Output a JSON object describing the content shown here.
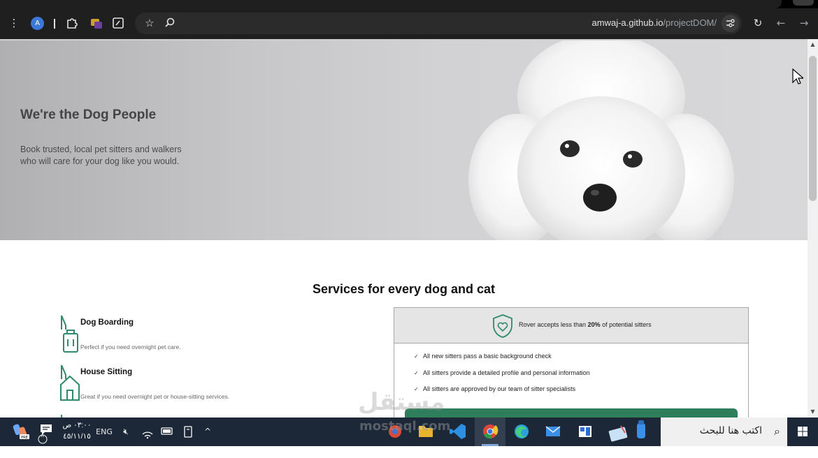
{
  "browser": {
    "url_host": "amwaj-a.github.io",
    "url_path": "/projectDOM/",
    "profile_initial": "A",
    "icons": [
      "menu-icon",
      "extensions-icon",
      "tab-search-icon",
      "bookmark-star-icon",
      "zoom-icon",
      "site-info-icon",
      "reload-icon",
      "back-icon",
      "forward-icon"
    ]
  },
  "hero": {
    "title": "We're the Dog People",
    "text": "Book trusted, local pet sitters and walkers who will care for your dog like you would."
  },
  "services": {
    "title": "Services for every dog and cat",
    "items": [
      {
        "title": "Dog Boarding",
        "desc": "Perfect if you need overnight pet care.",
        "icon": "suitcase-icon"
      },
      {
        "title": "House Sitting",
        "desc": "Great if you need overnight pet or house-sitting services.",
        "icon": "house-icon"
      }
    ]
  },
  "trust": {
    "prefix": "Rover accepts less than ",
    "highlight": "20%",
    "suffix": " of potential sitters",
    "checks": [
      "All new sitters pass a basic background check",
      "All sitters provide a detailed profile and personal information",
      "All sitters are approved by our team of sitter specialists"
    ],
    "check_mark": "✓",
    "accent": "#2e7d5b"
  },
  "watermark": {
    "arabic": "مستقل",
    "latin": "mostaql.com"
  },
  "taskbar": {
    "search_placeholder": "اكتب هنا للبحث",
    "language": "ENG",
    "time": "٠٣:٠٠ ص",
    "date": "٤٥/١١/١٥",
    "notification_count": "٨"
  }
}
